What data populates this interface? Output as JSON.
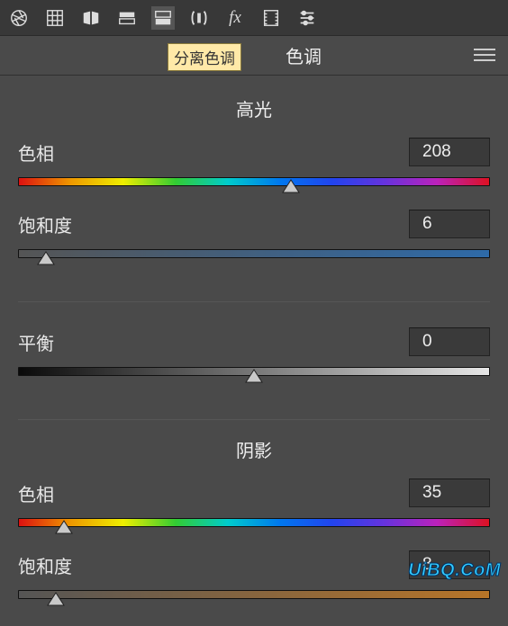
{
  "toolbar": {
    "icons": [
      "aperture-icon",
      "grid-icon",
      "mirror-icon",
      "before-after-h-icon",
      "before-after-v-icon",
      "lens-icon",
      "fx-icon",
      "filmstrip-icon",
      "sliders-icon"
    ]
  },
  "header": {
    "tooltip": "分离色调",
    "title": "色调"
  },
  "highlights": {
    "title": "高光",
    "hue_label": "色相",
    "hue_value": "208",
    "hue_min": 0,
    "hue_max": 360,
    "sat_label": "饱和度",
    "sat_value": "6",
    "sat_min": 0,
    "sat_max": 100
  },
  "balance": {
    "label": "平衡",
    "value": "0",
    "min": -100,
    "max": 100
  },
  "shadows": {
    "title": "阴影",
    "hue_label": "色相",
    "hue_value": "35",
    "hue_min": 0,
    "hue_max": 360,
    "sat_label": "饱和度",
    "sat_value": "8",
    "sat_min": 0,
    "sat_max": 100
  },
  "watermark": "UiBQ.CoM"
}
